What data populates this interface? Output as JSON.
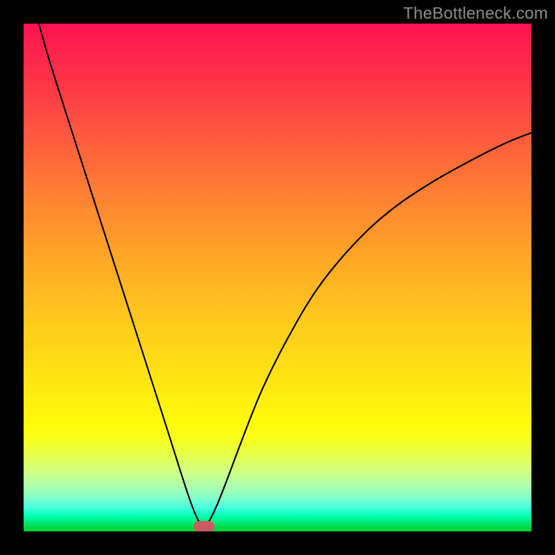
{
  "watermark": "TheBottleneck.com",
  "chart_data": {
    "type": "line",
    "title": "",
    "xlabel": "",
    "ylabel": "",
    "xlim": [
      0,
      100
    ],
    "ylim": [
      0,
      100
    ],
    "grid": false,
    "legend": false,
    "series": [
      {
        "name": "bottleneck-curve",
        "x": [
          3,
          5,
          8,
          12,
          16,
          20,
          24,
          28,
          31,
          33,
          34.5,
          35.5,
          36.5,
          38,
          40,
          43,
          47,
          52,
          58,
          65,
          72,
          80,
          88,
          95,
          100
        ],
        "y": [
          100,
          93,
          83.5,
          71,
          58.5,
          46,
          33.5,
          21,
          11.5,
          5.5,
          2,
          1,
          2,
          5,
          10,
          18,
          28,
          38,
          48,
          56.5,
          63,
          68.5,
          73,
          76.5,
          78.5
        ]
      }
    ],
    "marker": {
      "x": 35.5,
      "y": 1,
      "label": "optimal-point"
    },
    "background_gradient": {
      "top_color": "#ff1152",
      "mid_color": "#ffe014",
      "bottom_color": "#00d030"
    }
  }
}
